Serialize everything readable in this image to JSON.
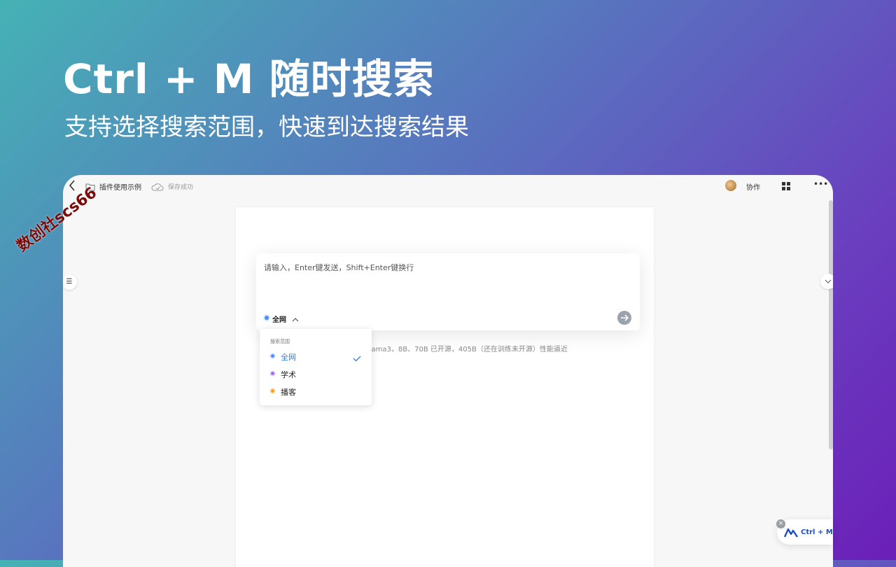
{
  "hero": {
    "title": "Ctrl + M 随时搜索",
    "subtitle": "支持选择搜索范围，快速到达搜索结果"
  },
  "topbar": {
    "doc_name": "插件使用示例",
    "save_status": "保存成功",
    "collab_label": "协作"
  },
  "editor": {
    "background_text": "型 Llama3，8B、70B 已开源，405B（还在训练未开源）性能逼近"
  },
  "search": {
    "placeholder": "请输入，Enter键发送，Shift+Enter键换行",
    "current_scope": "全网"
  },
  "dropdown": {
    "header": "搜索范围",
    "items": [
      {
        "label": "全网",
        "color": "#4c8dff",
        "selected": true
      },
      {
        "label": "学术",
        "color": "#a36cf0",
        "selected": false
      },
      {
        "label": "播客",
        "color": "#ff9a1f",
        "selected": false
      }
    ]
  },
  "shortcut_badge": {
    "label": "Ctrl + M"
  },
  "watermark": {
    "text": "数创社scs66"
  },
  "colors": {
    "accent": "#2b7de9",
    "brand_blue": "#1f4fbf"
  }
}
